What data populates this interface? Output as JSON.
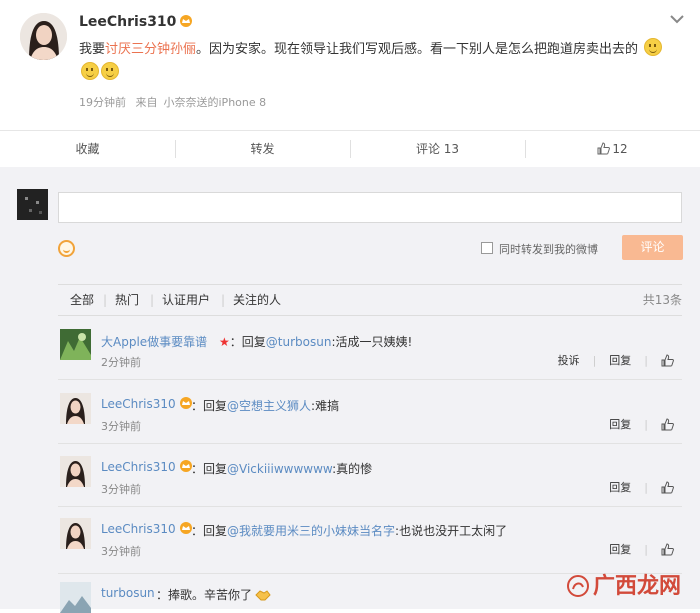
{
  "post": {
    "author": "LeeChris310",
    "text_before": "我要",
    "text_highlight": "讨厌三分钟孙俪",
    "text_after": "。因为安家。现在领导让我们写观后感。看一下别人是怎么把跑道房卖出去的",
    "time": "19分钟前",
    "source_prefix": "来自",
    "source": "小奈奈送的iPhone 8"
  },
  "actions": {
    "favorite": "收藏",
    "repost": "转发",
    "comment": "评论 13",
    "like": "12"
  },
  "compose": {
    "placeholder": "",
    "sync_label": "同时转发到我的微博",
    "submit": "评论"
  },
  "tabs": [
    "全部",
    "热门",
    "认证用户",
    "关注的人"
  ],
  "total": "共13条",
  "comments": [
    {
      "user": "大Apple做事要靠谱",
      "prefix": "：回复",
      "mention": "@turbosun",
      "body": ":活成一只姨姨!",
      "time": "2分钟前",
      "report": "投诉",
      "reply": "回复"
    },
    {
      "user": "LeeChris310",
      "prefix": "：回复",
      "mention": "@空想主义狮人",
      "body": ":难搞",
      "time": "3分钟前",
      "reply": "回复"
    },
    {
      "user": "LeeChris310",
      "prefix": "：回复",
      "mention": "@Vickiiiwwwwww",
      "body": ":真的惨",
      "time": "3分钟前",
      "reply": "回复"
    },
    {
      "user": "LeeChris310",
      "prefix": "：回复",
      "mention": "@我就要用米三的小妹妹当名字",
      "body": ":也说也没开工太闲了",
      "time": "3分钟前",
      "reply": "回复"
    },
    {
      "user": "turbosun",
      "prefix": "：",
      "mention": "",
      "body": "捧歌。辛苦你了",
      "time": "",
      "reply": ""
    }
  ],
  "watermark": "广西龙网",
  "colors": {
    "link": "#5b8bc2",
    "highlight": "#eb7350",
    "submit": "#f9b992",
    "background": "#f2f2f5"
  }
}
